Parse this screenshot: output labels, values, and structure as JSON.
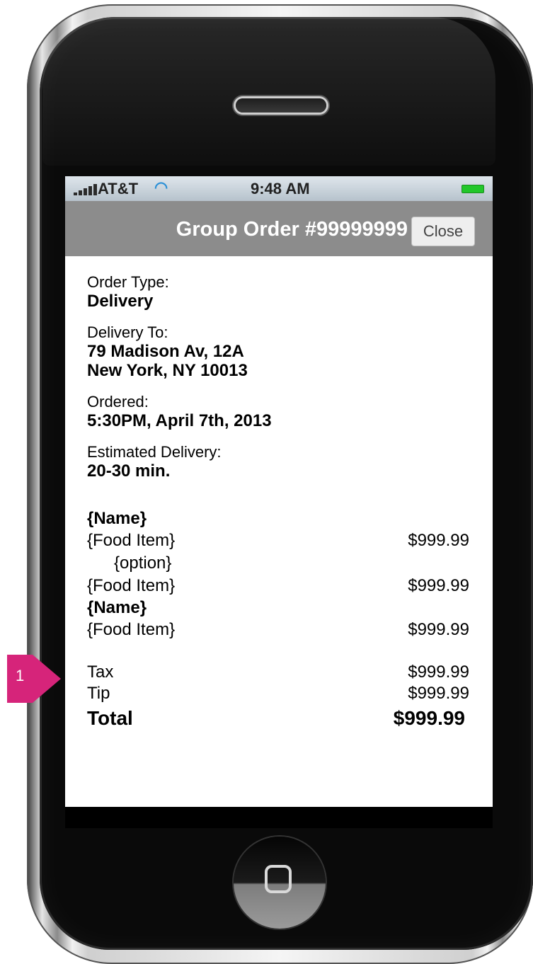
{
  "status_bar": {
    "carrier": "AT&T",
    "time": "9:48 AM",
    "icons": [
      "signal-icon",
      "wifi-icon",
      "battery-icon"
    ]
  },
  "nav": {
    "title": "Group Order #99999999",
    "close_label": "Close"
  },
  "order": {
    "order_type_label": "Order Type:",
    "order_type": "Delivery",
    "delivery_to_label": "Delivery To:",
    "address_line1": "79 Madison Av, 12A",
    "address_line2": "New York, NY 10013",
    "ordered_label": "Ordered:",
    "ordered_value": "5:30PM, April 7th, 2013",
    "estimated_label": "Estimated Delivery:",
    "estimated_value": "20-30 min."
  },
  "items": [
    {
      "type": "name",
      "text": "{Name}"
    },
    {
      "type": "item",
      "text": "{Food Item}",
      "price": "$999.99"
    },
    {
      "type": "option",
      "text": "{option}"
    },
    {
      "type": "item",
      "text": "{Food Item}",
      "price": "$999.99"
    },
    {
      "type": "name",
      "text": "{Name}"
    },
    {
      "type": "item",
      "text": "{Food Item}",
      "price": "$999.99"
    }
  ],
  "totals": {
    "tax_label": "Tax",
    "tax": "$999.99",
    "tip_label": "Tip",
    "tip": "$999.99",
    "total_label": "Total",
    "total": "$999.99"
  },
  "annotation": {
    "callout_number": "1",
    "color": "#d6247a"
  }
}
